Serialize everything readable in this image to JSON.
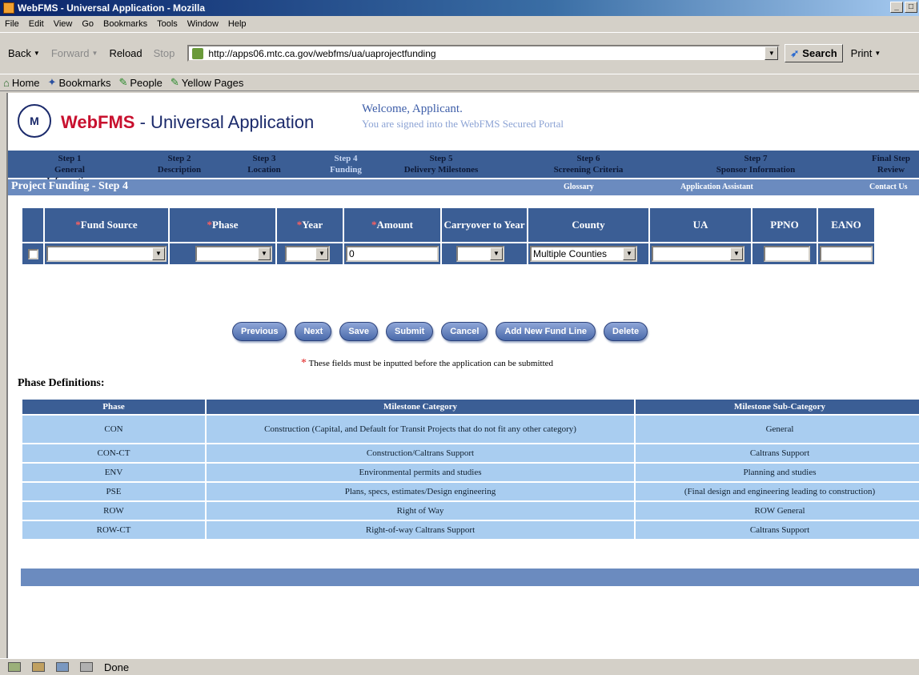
{
  "window": {
    "title": "WebFMS - Universal Application - Mozilla"
  },
  "menu": [
    "File",
    "Edit",
    "View",
    "Go",
    "Bookmarks",
    "Tools",
    "Window",
    "Help"
  ],
  "nav": {
    "back": "Back",
    "forward": "Forward",
    "reload": "Reload",
    "stop": "Stop",
    "url": "http://apps06.mtc.ca.gov/webfms/ua/uaprojectfunding",
    "search": "Search",
    "print": "Print"
  },
  "bookmarks": [
    "Home",
    "Bookmarks",
    "People",
    "Yellow Pages"
  ],
  "header": {
    "logo_mark": "M",
    "logo_web": "Web",
    "logo_fms": "FMS",
    "logo_rest": " - Universal Application",
    "welcome": "Welcome, Applicant.",
    "welcome_sub": "You are signed into the WebFMS Secured Portal"
  },
  "steps": [
    {
      "num": "Step 1",
      "name": "General Information"
    },
    {
      "num": "Step 2",
      "name": "Description"
    },
    {
      "num": "Step 3",
      "name": "Location"
    },
    {
      "num": "Step 4",
      "name": "Funding"
    },
    {
      "num": "Step 5",
      "name": "Delivery Milestones"
    },
    {
      "num": "Step 6",
      "name": "Screening Criteria"
    },
    {
      "num": "Step 7",
      "name": "Sponsor Information"
    },
    {
      "num": "Final Step",
      "name": "Review"
    }
  ],
  "subbar": {
    "title": "Project Funding - Step 4",
    "glossary": "Glossary",
    "assistant": "Application Assistant",
    "contact": "Contact Us"
  },
  "funding": {
    "columns": [
      "Fund Source",
      "Phase",
      "Year",
      "Amount",
      "Carryover to Year",
      "County",
      "UA",
      "PPNO",
      "EANO"
    ],
    "row": {
      "amount": "0",
      "county": "Multiple Counties"
    }
  },
  "buttons": {
    "previous": "Previous",
    "next": "Next",
    "save": "Save",
    "submit": "Submit",
    "cancel": "Cancel",
    "add": "Add New Fund Line",
    "delete": "Delete"
  },
  "note": "These fields must be inputted before the application can be submitted",
  "phase_defs": {
    "heading": "Phase Definitions:",
    "headers": [
      "Phase",
      "Milestone Category",
      "Milestone Sub-Category"
    ],
    "rows": [
      [
        "CON",
        "Construction (Capital, and Default for Transit Projects that do not fit any other category)",
        "General"
      ],
      [
        "CON-CT",
        "Construction/Caltrans Support",
        "Caltrans Support"
      ],
      [
        "ENV",
        "Environmental permits and studies",
        "Planning and studies"
      ],
      [
        "PSE",
        "Plans, specs, estimates/Design engineering",
        "(Final design and engineering leading to construction)"
      ],
      [
        "ROW",
        "Right of Way",
        "ROW General"
      ],
      [
        "ROW-CT",
        "Right-of-way Caltrans Support",
        "Caltrans Support"
      ]
    ]
  },
  "status": {
    "text": "Done"
  }
}
